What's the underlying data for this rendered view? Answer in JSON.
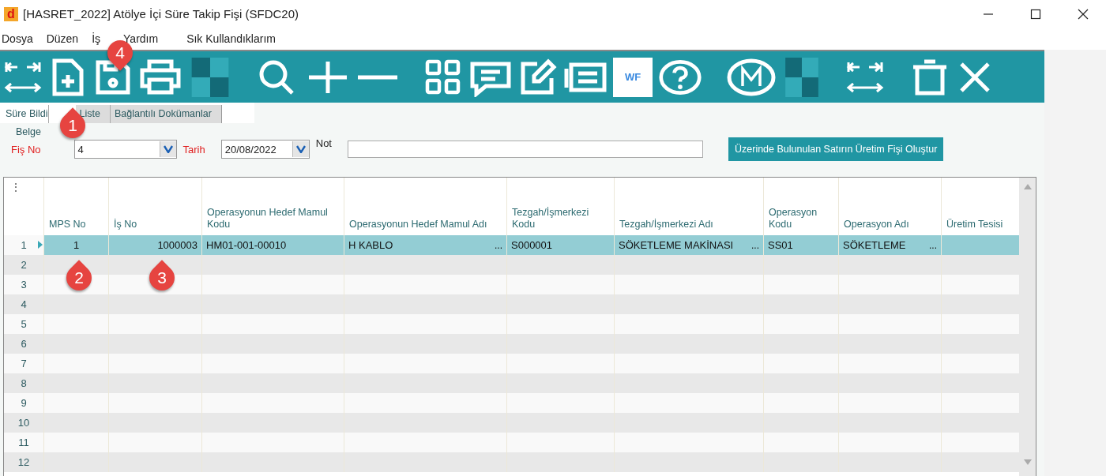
{
  "window": {
    "app_letter": "d",
    "title": "[HASRET_2022] Atölye İçi Süre Takip Fişi (SFDC20)"
  },
  "menu": [
    "Dosya",
    "Düzen",
    "İş",
    "Yardım",
    "Sık Kullandıklarım"
  ],
  "toolbar": {
    "wf_label": "WF"
  },
  "tabs": [
    {
      "label": "Süre Bildi",
      "selected": true
    },
    {
      "label": "Liste",
      "selected": false
    },
    {
      "label": "Bağlantılı Dokümanlar",
      "selected": false
    }
  ],
  "form": {
    "group": "Belge",
    "fis_no": {
      "label": "Fiş No",
      "value": "4"
    },
    "tarih": {
      "label": "Tarih",
      "value": "20/08/2022"
    },
    "not": {
      "label": "Not"
    },
    "action_button": "Üzerinde Bulunulan Satırın Üretim Fişi Oluştur"
  },
  "grid": {
    "corner": "⋮",
    "columns": [
      {
        "label": "MPS No"
      },
      {
        "label": "İş No"
      },
      {
        "label": "Operasyonun Hedef Mamul Kodu"
      },
      {
        "label": "Operasyonun Hedef Mamul Adı"
      },
      {
        "label": "Tezgah/İşmerkezi Kodu"
      },
      {
        "label": "Tezgah/İşmerkezi Adı"
      },
      {
        "label": "Operasyon Kodu"
      },
      {
        "label": "Operasyon Adı"
      },
      {
        "label": "Üretim Tesisi"
      }
    ],
    "rows": [
      {
        "number": "1",
        "selected": true,
        "cells": [
          {
            "text": "1"
          },
          {
            "text": "1000003"
          },
          {
            "text": "HM01-001-00010"
          },
          {
            "text": "H KABLO",
            "button": "..."
          },
          {
            "text": "S000001"
          },
          {
            "text": "SÖKETLEME MAKİNASI",
            "button": "..."
          },
          {
            "text": "SS01"
          },
          {
            "text": "SÖKETLEME",
            "button": "..."
          },
          {}
        ]
      },
      {
        "number": "2",
        "selected": false
      },
      {
        "number": "3",
        "selected": false
      },
      {
        "number": "4",
        "selected": false
      },
      {
        "number": "5",
        "selected": false
      },
      {
        "number": "6",
        "selected": false
      },
      {
        "number": "7",
        "selected": false
      },
      {
        "number": "8",
        "selected": false
      },
      {
        "number": "9",
        "selected": false
      },
      {
        "number": "10",
        "selected": false
      },
      {
        "number": "11",
        "selected": false
      },
      {
        "number": "12",
        "selected": false
      }
    ]
  },
  "callouts": [
    "1",
    "2",
    "3",
    "4"
  ]
}
